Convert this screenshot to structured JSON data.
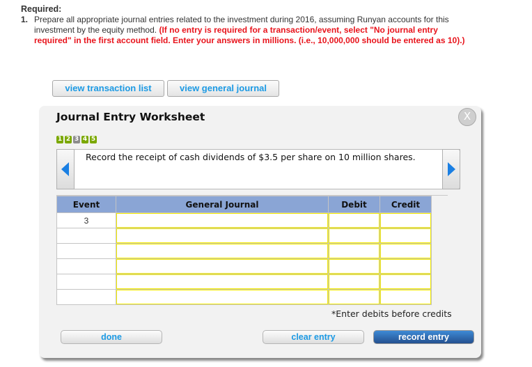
{
  "required": {
    "title": "Required:",
    "item_number": "1.",
    "text_plain": "Prepare all appropriate journal entries related to the investment during 2016, assuming Runyan accounts for this investment by the equity method.",
    "text_red": "(If no entry is required for a transaction/event, select \"No journal entry required\" in the first account field. Enter your answers in millions. (i.e., 10,000,000 should be entered as 10).)"
  },
  "top_buttons": {
    "view_transaction_list": "view transaction list",
    "view_general_journal": "view general journal"
  },
  "worksheet": {
    "title": "Journal Entry Worksheet",
    "close_label": "X",
    "steps": [
      {
        "label": "1",
        "state": "completed"
      },
      {
        "label": "2",
        "state": "completed"
      },
      {
        "label": "3",
        "state": "current"
      },
      {
        "label": "4",
        "state": "completed"
      },
      {
        "label": "5",
        "state": "completed"
      }
    ],
    "description": "Record the receipt of cash dividends of $3.5 per share on 10 million shares.",
    "table": {
      "headers": [
        "Event",
        "General Journal",
        "Debit",
        "Credit"
      ],
      "rows": [
        {
          "event": "3",
          "account": "",
          "debit": "",
          "credit": ""
        },
        {
          "event": "",
          "account": "",
          "debit": "",
          "credit": ""
        },
        {
          "event": "",
          "account": "",
          "debit": "",
          "credit": ""
        },
        {
          "event": "",
          "account": "",
          "debit": "",
          "credit": ""
        },
        {
          "event": "",
          "account": "",
          "debit": "",
          "credit": ""
        },
        {
          "event": "",
          "account": "",
          "debit": "",
          "credit": ""
        }
      ]
    },
    "note": "*Enter debits before credits",
    "buttons": {
      "done": "done",
      "clear_entry": "clear entry",
      "record_entry": "record entry"
    }
  },
  "colors": {
    "accent_link": "#1c9ae4",
    "instruction_red": "#e8141c",
    "header_blue": "#8aa5d5",
    "step_green": "#7ba800",
    "input_border_yellow": "#f5ec00",
    "primary_button": "#2c63a8"
  }
}
